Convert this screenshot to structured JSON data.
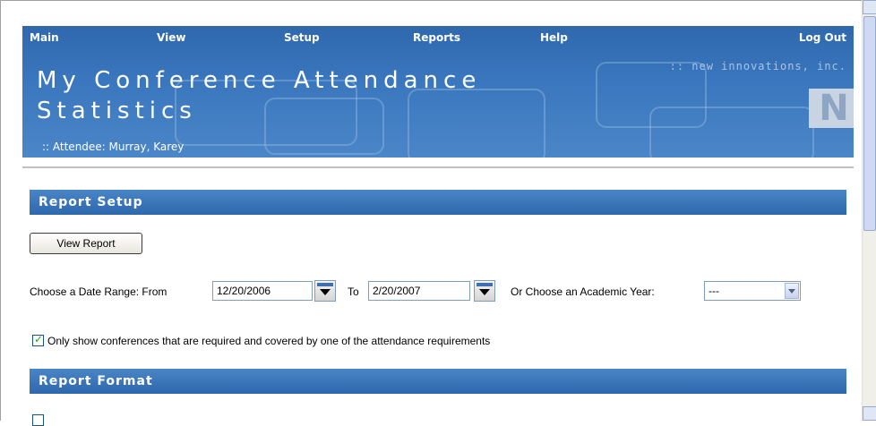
{
  "nav": {
    "main": "Main",
    "view": "View",
    "setup": "Setup",
    "reports": "Reports",
    "help": "Help",
    "logout": "Log Out"
  },
  "header": {
    "title_line1": "My Conference Attendance",
    "title_line2": "Statistics",
    "attendee": ":: Attendee: Murray, Karey",
    "brand": ":: new innovations, inc."
  },
  "report_setup": {
    "section_title": "Report Setup",
    "view_report_label": "View Report",
    "date_range_label": "Choose a Date Range:  From",
    "from_date": "12/20/2006",
    "to_label": "To",
    "to_date": "2/20/2007",
    "academic_year_label": "Or Choose an Academic Year:",
    "academic_year_value": "---",
    "only_required_label": "Only show conferences that are required and covered by one of the attendance requirements",
    "only_required_checked": true
  },
  "report_format": {
    "section_title": "Report Format"
  }
}
